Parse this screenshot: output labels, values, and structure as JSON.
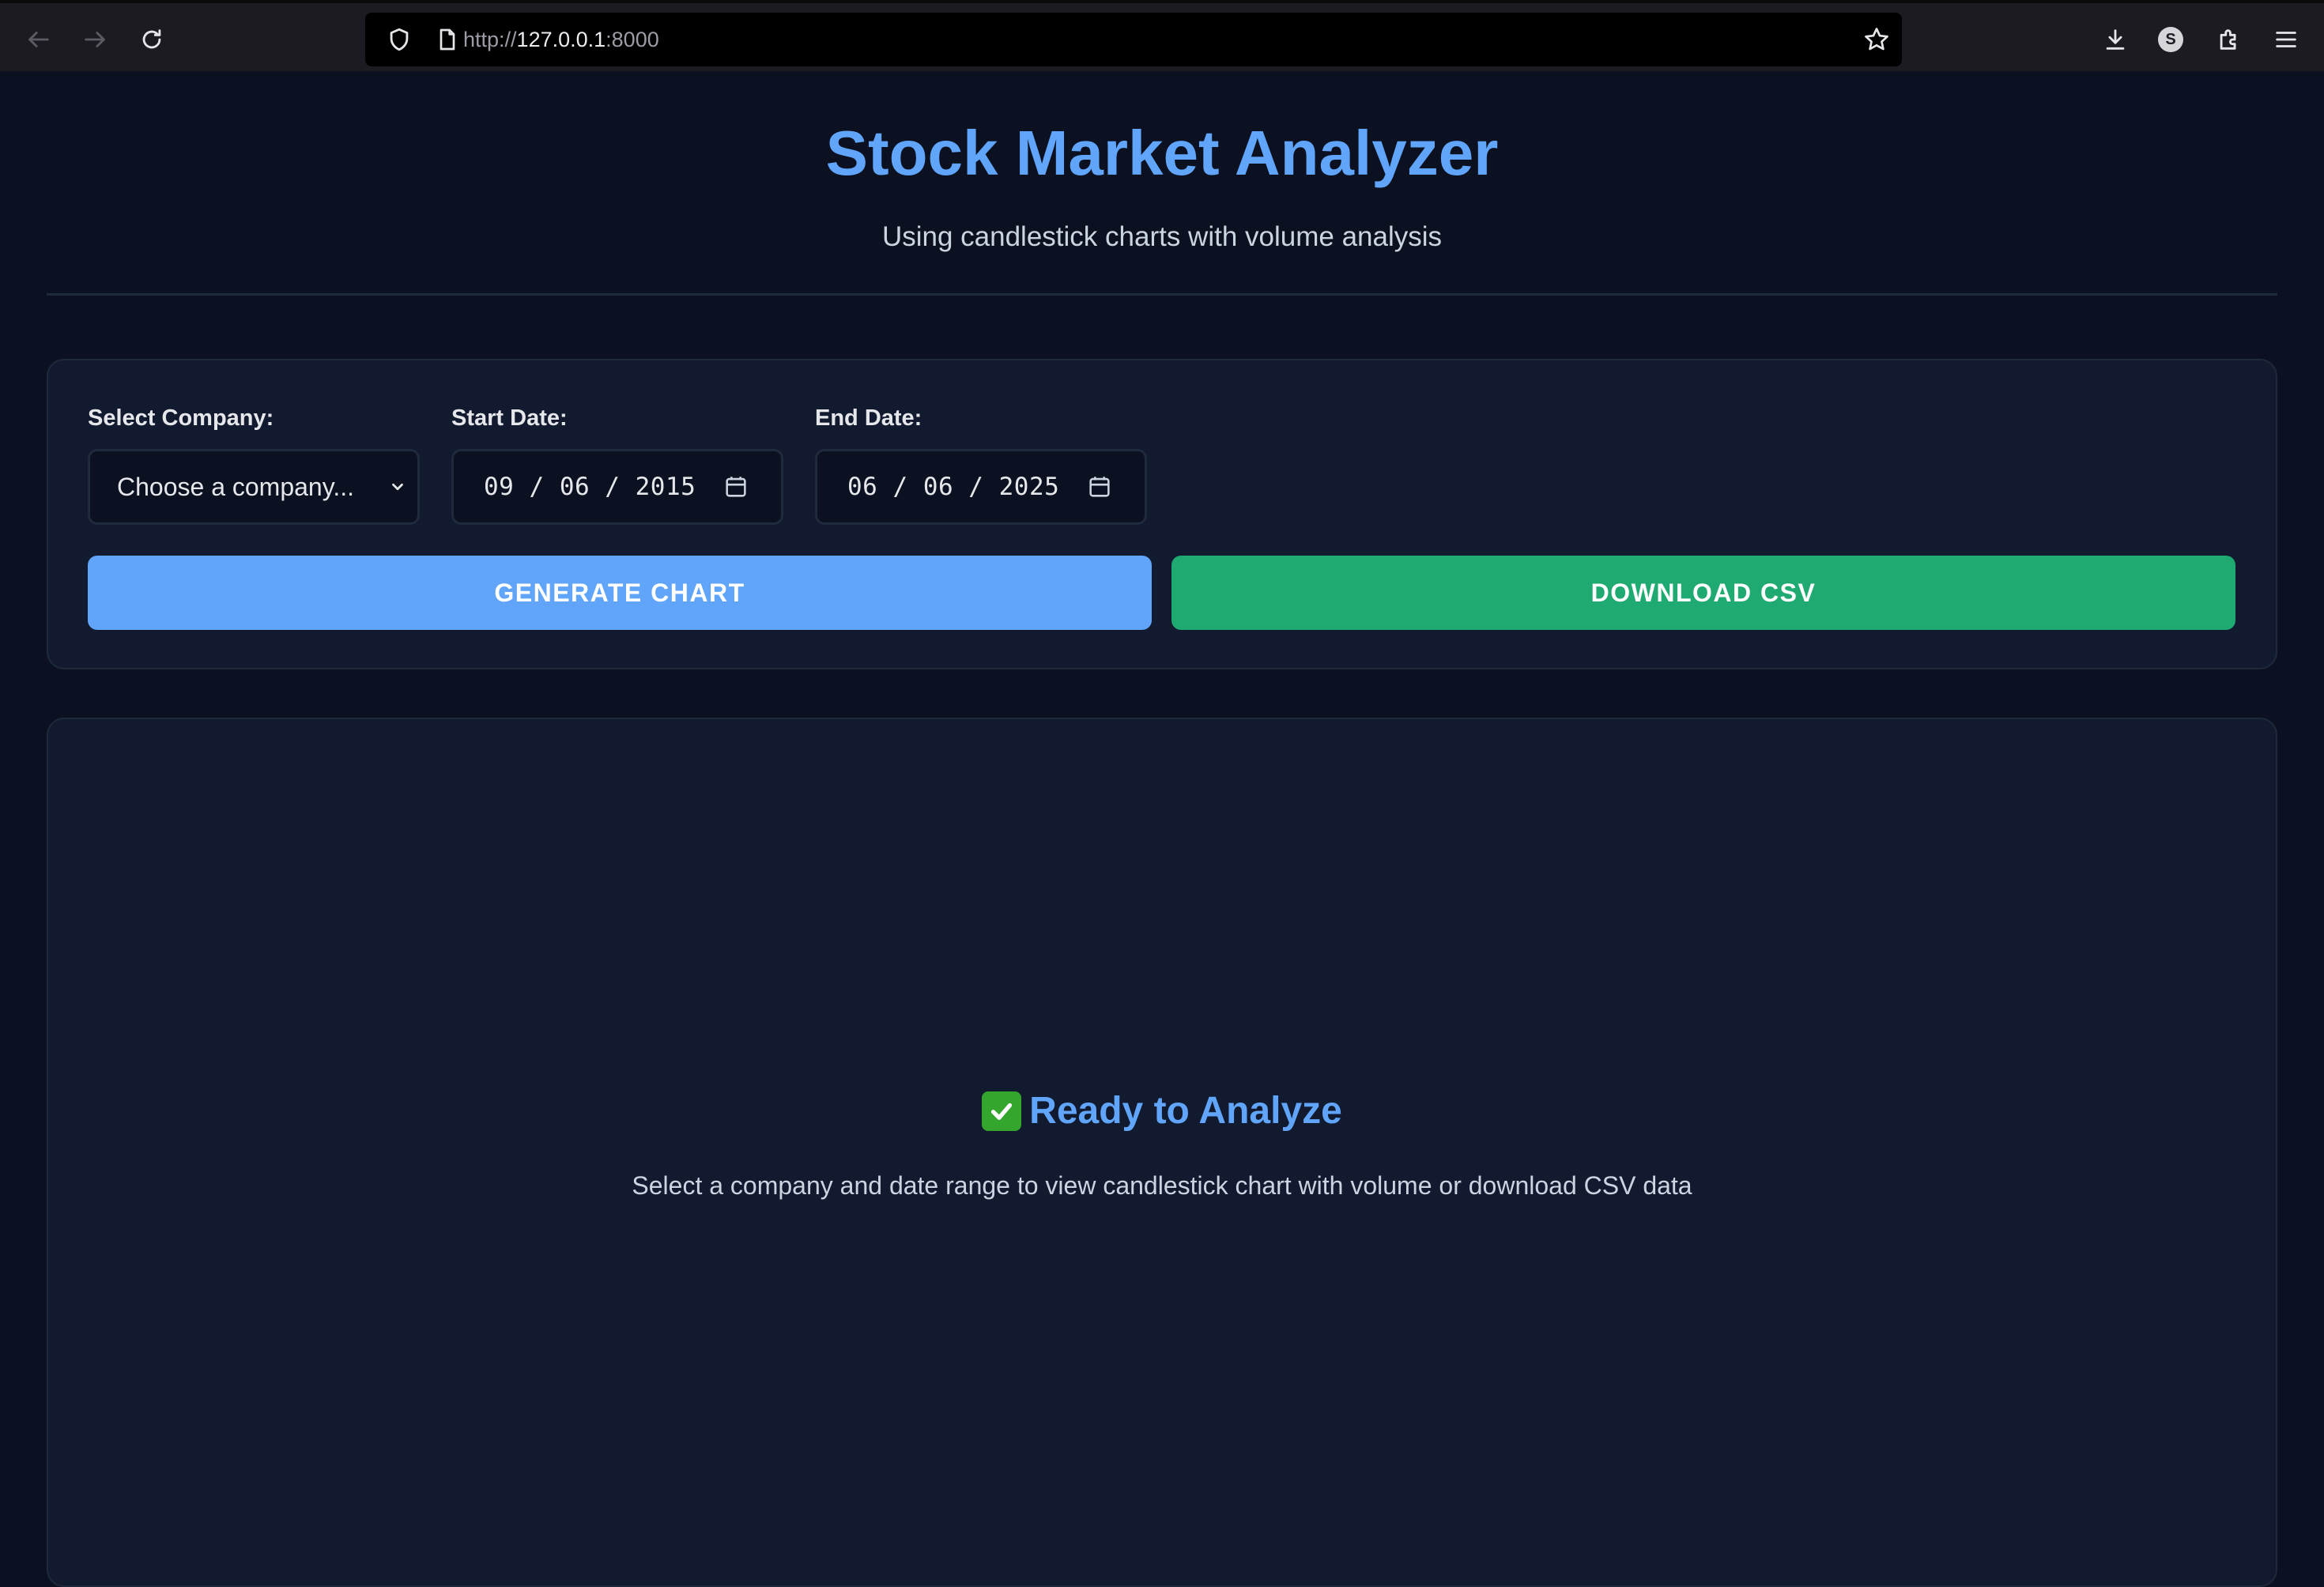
{
  "browser": {
    "url_scheme": "http://",
    "url_host": "127.0.0.1",
    "url_port": ":8000",
    "profile_initial": "S",
    "icons": [
      "back-icon",
      "forward-icon",
      "reload-icon",
      "shield-icon",
      "page-icon",
      "bookmark-star-icon",
      "downloads-icon",
      "extensions-icon",
      "menu-icon"
    ]
  },
  "header": {
    "title": "Stock Market Analyzer",
    "subtitle": "Using candlestick charts with volume analysis"
  },
  "controls": {
    "company_label": "Select Company:",
    "company_value": "Choose a company...",
    "start_label": "Start Date:",
    "start_value": "09 / 06 / 2015",
    "end_label": "End Date:",
    "end_value": "06 / 06 / 2025",
    "generate_label": "GENERATE CHART",
    "download_label": "DOWNLOAD CSV"
  },
  "result": {
    "title": "Ready to Analyze",
    "description": "Select a company and date range to view candlestick chart with volume or download CSV data"
  },
  "colors": {
    "page_bg": "#0b1120",
    "card_bg": "#111a2e",
    "accent_blue": "#60a5fa",
    "accent_green": "#1faa71",
    "browser_bar": "#1c1b22"
  }
}
